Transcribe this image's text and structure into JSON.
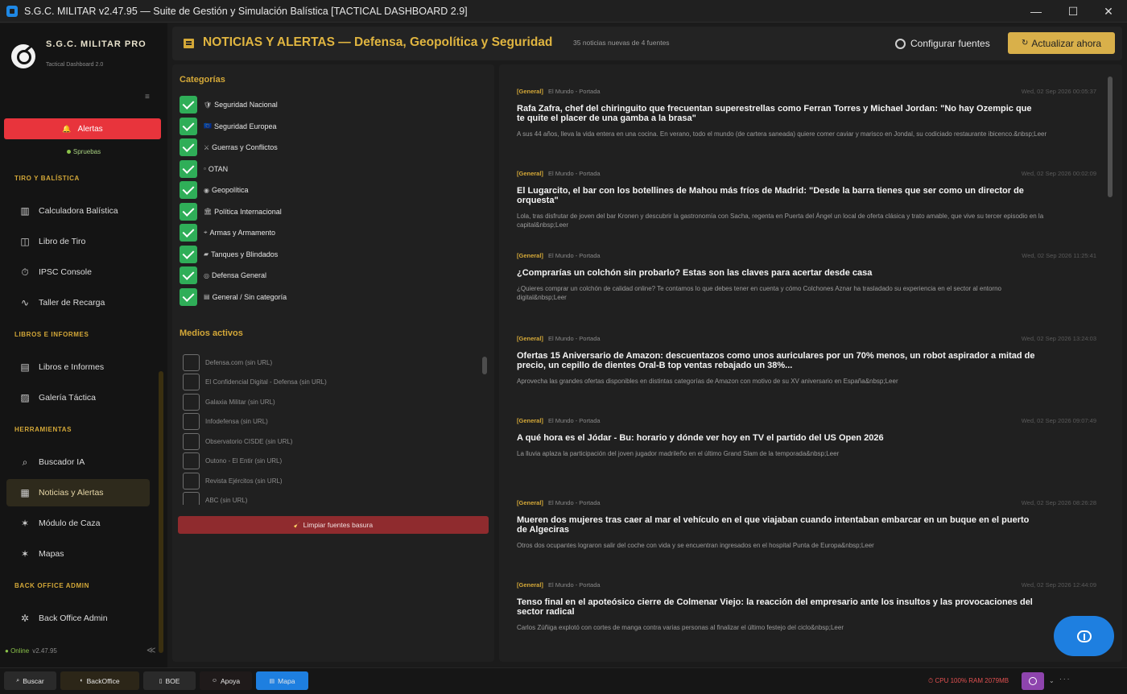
{
  "window": {
    "title": "S.G.C. MILITAR v2.47.95 — Suite de Gestión y Simulación Balística [TACTICAL DASHBOARD 2.9]",
    "minimize": "—",
    "maximize": "☐",
    "close": "✕"
  },
  "sidebar": {
    "brand": "S.G.C. MILITAR PRO",
    "brand_sub": "Tactical Dashboard 2.0",
    "menu_icon": "≡",
    "alert_button": "Alertas",
    "alert_icon": "bell-icon",
    "status_text": "Spruebas",
    "sections": {
      "tiro": "TIRO Y BALÍSTICA",
      "libros": "LIBROS E INFORMES",
      "herramientas": "HERRAMIENTAS",
      "admin": "BACK OFFICE ADMIN"
    },
    "items": [
      {
        "label": "Calculadora Balística",
        "icon": "▥"
      },
      {
        "label": "Libro de Tiro",
        "icon": "◫"
      },
      {
        "label": "IPSC Console",
        "icon": "⏱"
      },
      {
        "label": "Taller de Recarga",
        "icon": "∿"
      },
      {
        "label": "Libros e Informes",
        "icon": "▤"
      },
      {
        "label": "Galería Táctica",
        "icon": "▨"
      },
      {
        "label": "Buscador IA",
        "icon": "⌕"
      },
      {
        "label": "Noticias y Alertas",
        "icon": "▦"
      },
      {
        "label": "Módulo de Caza",
        "icon": "✶"
      },
      {
        "label": "Mapas",
        "icon": "✶"
      },
      {
        "label": "Back Office Admin",
        "icon": "✲"
      }
    ],
    "online": "Online",
    "version": "v2.47.95",
    "collapse_icon": "≪"
  },
  "header": {
    "title": "NOTICIAS Y ALERTAS — Defensa, Geopolítica y Seguridad",
    "count": "35 noticias nuevas de 4 fuentes",
    "config_label": "Configurar fuentes",
    "update_label": "Actualizar ahora",
    "update_icon": "↻"
  },
  "categories": {
    "title": "Categorías",
    "items": [
      {
        "glyph": "🛡",
        "label": "Seguridad Nacional"
      },
      {
        "glyph": "🇪🇺",
        "label": "Seguridad Europea"
      },
      {
        "glyph": "⚔",
        "label": "Guerras y Conflictos"
      },
      {
        "glyph": "▫",
        "label": "OTAN"
      },
      {
        "glyph": "◉",
        "label": "Geopolítica"
      },
      {
        "glyph": "🏛",
        "label": "Política Internacional"
      },
      {
        "glyph": "⌖",
        "label": "Armas y Armamento"
      },
      {
        "glyph": "▰",
        "label": "Tanques y Blindados"
      },
      {
        "glyph": "◎",
        "label": "Defensa General"
      },
      {
        "glyph": "▤",
        "label": "General / Sin categoría"
      }
    ]
  },
  "media": {
    "title": "Medios activos",
    "items": [
      {
        "label": "Defensa.com  (sin URL)"
      },
      {
        "label": "El Confidencial Digital - Defensa  (sin URL)"
      },
      {
        "label": "Galaxia Militar  (sin URL)"
      },
      {
        "label": "Infodefensa  (sin URL)"
      },
      {
        "label": "Observatorio CISDE  (sin URL)"
      },
      {
        "label": "Outono - El Entir  (sin URL)"
      },
      {
        "label": "Revista Ejércitos  (sin URL)"
      },
      {
        "label": "ABC  (sin URL)"
      }
    ],
    "clean_label": "Limpiar fuentes basura",
    "clean_icon": "🧹"
  },
  "news": [
    {
      "tag": "[General]",
      "source": "El Mundo - Portada",
      "date": "Wed, 02 Sep 2026 00:05:37",
      "headline": "Rafa Zafra, chef del chiringuito que frecuentan superestrellas como Ferran Torres y Michael Jordan: \"No hay Ozempic que te quite el placer de una gamba a la brasa\"",
      "summary": "A sus 44 años, lleva la vida entera en una cocina. En verano, todo el mundo (de cartera saneada) quiere comer caviar y marisco en Jondal, su codiciado restaurante ibicenco.&nbsp;Leer"
    },
    {
      "tag": "[General]",
      "source": "El Mundo - Portada",
      "date": "Wed, 02 Sep 2026 00:02:09",
      "headline": "El Lugarcito, el bar con los botellines de Mahou más fríos de Madrid: \"Desde la barra tienes que ser como un director de orquesta\"",
      "summary": "Lola, tras disfrutar de joven del bar Kronen y descubrir la gastronomía con Sacha, regenta en Puerta del Ángel un local de oferta clásica y trato amable, que vive su tercer episodio en la capital&nbsp;Leer"
    },
    {
      "tag": "[General]",
      "source": "El Mundo - Portada",
      "date": "Wed, 02 Sep 2026 11:25:41",
      "headline": "¿Comprarías un colchón sin probarlo? Estas son las claves para acertar desde casa",
      "summary": "¿Quieres comprar un colchón de calidad online? Te contamos lo que debes tener en cuenta y cómo Colchones Aznar ha trasladado su experiencia en el sector al entorno digital&nbsp;Leer"
    },
    {
      "tag": "[General]",
      "source": "El Mundo - Portada",
      "date": "Wed, 02 Sep 2026 13:24:03",
      "headline": "Ofertas 15 Aniversario de Amazon: descuentazos como unos auriculares por un 70% menos, un robot aspirador a mitad de precio, un cepillo de dientes Oral-B top ventas rebajado un 38%...",
      "summary": "Aprovecha las grandes ofertas disponibles en distintas categorías de Amazon con motivo de su XV aniversario en España&nbsp;Leer"
    },
    {
      "tag": "[General]",
      "source": "El Mundo - Portada",
      "date": "Wed, 02 Sep 2026 09:07:49",
      "headline": "A qué hora es el Jódar - Bu: horario y dónde ver hoy en TV el partido del US Open 2026",
      "summary": "La lluvia aplaza la participación del  joven jugador madrileño  en el último Grand Slam de la temporada&nbsp;Leer"
    },
    {
      "tag": "[General]",
      "source": "El Mundo - Portada",
      "date": "Wed, 02 Sep 2026 08:26:28",
      "headline": "Mueren dos mujeres tras caer al mar el vehículo en el que viajaban cuando intentaban embarcar en un buque  en el puerto de Algeciras",
      "summary": "Otros dos ocupantes lograron salir del coche con vida y se encuentran ingresados en el hospital Punta de Europa&nbsp;Leer"
    },
    {
      "tag": "[General]",
      "source": "El Mundo - Portada",
      "date": "Wed, 02 Sep 2026 12:44:09",
      "headline": "Tenso final en el apoteósico cierre de Colmenar Viejo: la reacción del empresario ante los insultos y las provocaciones del sector radical",
      "summary": "Carlos Zúñiga explotó con cortes de manga contra varias personas al finalizar el último festejo del ciclo&nbsp;Leer"
    }
  ],
  "taskbar": {
    "buttons": [
      {
        "label": "Buscar",
        "icon": "⌕"
      },
      {
        "label": "BackOffice",
        "icon": "◐"
      },
      {
        "label": "BOE",
        "icon": "▯"
      },
      {
        "label": "Apoya",
        "icon": "☺"
      },
      {
        "label": "Mapa",
        "icon": "▤"
      }
    ],
    "cpu": "CPU 100%  RAM 2079MB",
    "cpu_icon": "⏱",
    "tray_arrow": "⌄",
    "clock": "·  ·  ·"
  },
  "colors": {
    "accent": "#d4a838",
    "alert": "#e8343c",
    "check": "#2fae58",
    "fab": "#1e7fe0"
  }
}
